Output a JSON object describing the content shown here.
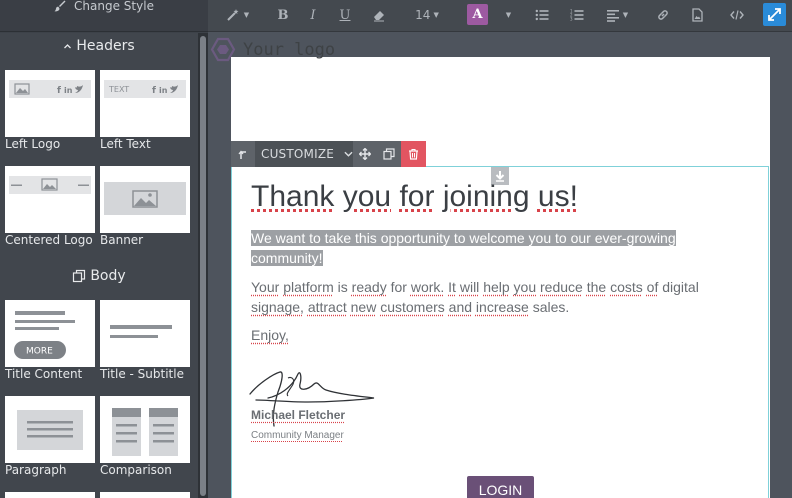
{
  "sidebar": {
    "change_style_label": "Change Style",
    "sections": [
      {
        "title": "Headers",
        "icon": "chevron-up-icon"
      },
      {
        "title": "Body",
        "icon": "copy-icon"
      }
    ],
    "snippets": [
      {
        "label": "Left Logo",
        "preview_text": ""
      },
      {
        "label": "Left Text",
        "preview_text": "TEXT"
      },
      {
        "label": "Centered Logo",
        "preview_text": ""
      },
      {
        "label": "Banner",
        "preview_text": ""
      },
      {
        "label": "Title Content",
        "preview_text": "MORE"
      },
      {
        "label": "Title - Subtitle",
        "preview_text": ""
      },
      {
        "label": "Paragraph",
        "preview_text": ""
      },
      {
        "label": "Comparison",
        "preview_text": ""
      }
    ]
  },
  "toolbar": {
    "font_size": "14",
    "color_letter": "A",
    "accent_color": "#9d5aa1",
    "active_color": "#2a8bd8",
    "icons": [
      "magic-wand-icon",
      "bold-icon",
      "italic-icon",
      "underline-icon",
      "eraser-icon",
      "font-size-dropdown",
      "text-color-icon",
      "unordered-list-icon",
      "ordered-list-icon",
      "align-icon",
      "link-icon",
      "file-icon",
      "code-icon",
      "fullscreen-icon"
    ]
  },
  "email": {
    "logo_text": "Your logo",
    "block_toolbar": {
      "customize_label": "CUSTOMIZE",
      "delete_color": "#e25561"
    },
    "headline_words": [
      "Thank",
      "you",
      "for",
      "joining",
      "us!"
    ],
    "highlight_paragraph": "We want to take this opportunity to welcome you to our ever-growing community!",
    "body_paragraph": "Your platform is ready for work. It will help you reduce the costs of digital signage, attract new customers and increase sales.",
    "enjoy": "Enjoy,",
    "signature_name": "Michael Fletcher",
    "signature_title": "Community Manager",
    "button_label": "LOGIN",
    "button_color": "#6a5077"
  }
}
